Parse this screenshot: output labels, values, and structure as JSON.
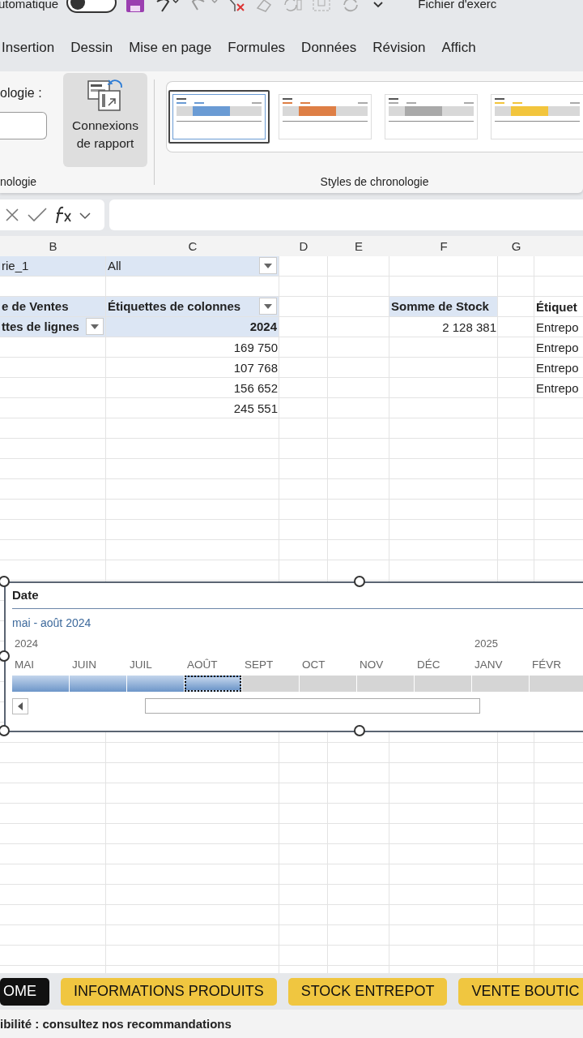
{
  "quick_access": {
    "autosave_label": "utomatique",
    "autosave_on": false,
    "file_title": "Fichier d'exerc"
  },
  "ribbon_tabs": [
    "Insertion",
    "Dessin",
    "Mise en page",
    "Formules",
    "Données",
    "Révision",
    "Affich"
  ],
  "ribbon": {
    "caption_label": "ologie :",
    "connections_button": "Connexions de rapport",
    "group_left": "nologie",
    "group_styles": "Styles de chronologie",
    "styles": [
      {
        "color": "#6a9bd4",
        "selected": true
      },
      {
        "color": "#de7f45",
        "selected": false
      },
      {
        "color": "#a9a9a9",
        "selected": false
      },
      {
        "color": "#f2c53d",
        "selected": false
      }
    ]
  },
  "columns": [
    "B",
    "C",
    "D",
    "E",
    "F",
    "G"
  ],
  "pivot_filter": {
    "field": "rie_1",
    "value": "All"
  },
  "pivot_table": {
    "value_header": "e de Ventes",
    "column_header": "Étiquettes de colonnes",
    "row_header": "ttes de lignes",
    "column_item": "2024",
    "values": [
      "169 750",
      "107 768",
      "156 652",
      "245 551"
    ]
  },
  "stock_pivot": {
    "header": "Somme de Stock",
    "value": "2 128 381"
  },
  "column_8": {
    "header": "Étiquet",
    "items": [
      "Entrepo",
      "Entrepo",
      "Entrepo",
      "Entrepo"
    ]
  },
  "timeline": {
    "title": "Date",
    "range": "mai - août 2024",
    "months": [
      {
        "label": "MAI",
        "year": "2024",
        "selected": true,
        "focused": false
      },
      {
        "label": "JUIN",
        "selected": true,
        "focused": false
      },
      {
        "label": "JUIL",
        "selected": true,
        "focused": false
      },
      {
        "label": "AOÛT",
        "selected": true,
        "focused": true
      },
      {
        "label": "SEPT",
        "selected": false,
        "focused": false
      },
      {
        "label": "OCT",
        "selected": false,
        "focused": false
      },
      {
        "label": "NOV",
        "selected": false,
        "focused": false
      },
      {
        "label": "DÉC",
        "selected": false,
        "focused": false
      },
      {
        "label": "JANV",
        "year": "2025",
        "selected": false,
        "focused": false
      },
      {
        "label": "FÉVR",
        "selected": false,
        "focused": false
      }
    ]
  },
  "sheet_tabs": [
    {
      "label": "OME",
      "selected": true
    },
    {
      "label": "INFORMATIONS PRODUITS",
      "selected": false
    },
    {
      "label": "STOCK ENTREPOT",
      "selected": false
    },
    {
      "label": "VENTE BOUTIC",
      "selected": false
    }
  ],
  "status_bar": "ibilité : consultez nos recommandations"
}
